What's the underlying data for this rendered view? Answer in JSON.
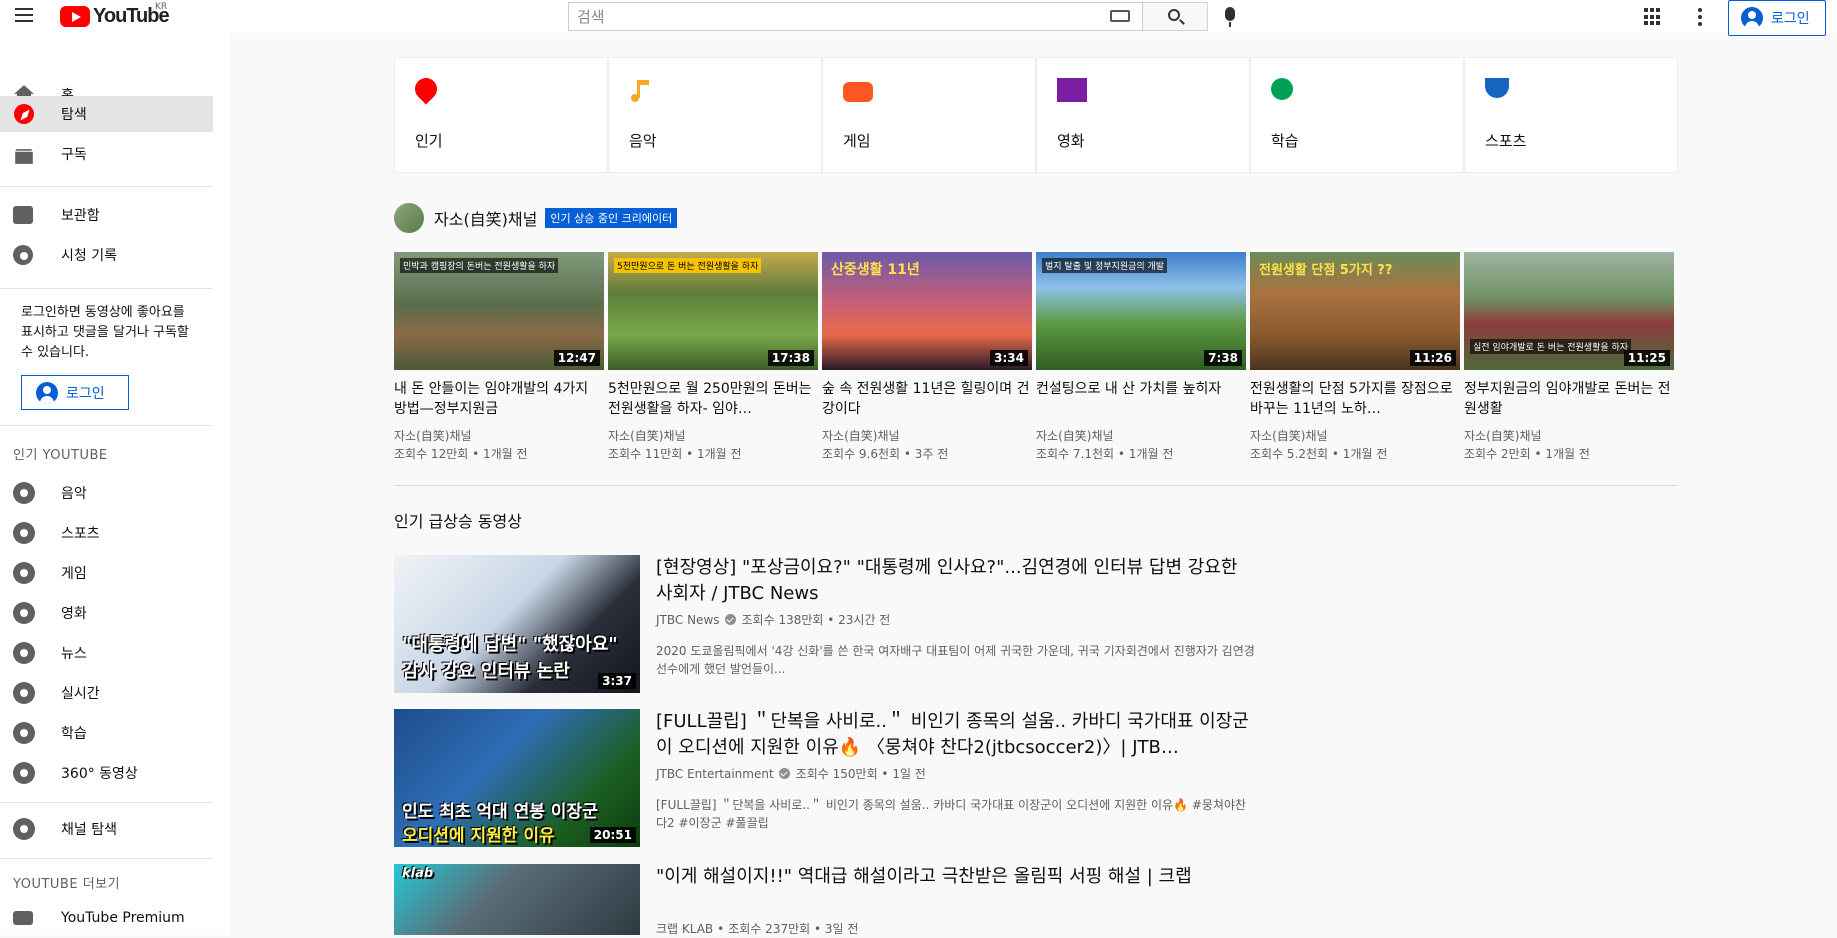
{
  "header": {
    "logo_text": "YouTube",
    "region": "KR",
    "search_placeholder": "검색",
    "login_label": "로그인"
  },
  "sidebar": {
    "main_items": [
      {
        "label": "홈",
        "icon": "home-icon"
      },
      {
        "label": "탐색",
        "icon": "explore-icon",
        "active": true
      },
      {
        "label": "구독",
        "icon": "subscriptions-icon"
      }
    ],
    "library_items": [
      {
        "label": "보관함",
        "icon": "library-icon"
      },
      {
        "label": "시청 기록",
        "icon": "history-icon"
      }
    ],
    "login_prompt": "로그인하면 동영상에 좋아요를 표시하고 댓글을 달거나 구독할 수 있습니다.",
    "login_button": "로그인",
    "popular_heading": "인기 YOUTUBE",
    "popular_items": [
      {
        "label": "음악",
        "icon": "music-icon"
      },
      {
        "label": "스포츠",
        "icon": "trophy-icon"
      },
      {
        "label": "게임",
        "icon": "gaming-icon"
      },
      {
        "label": "영화",
        "icon": "movie-icon"
      },
      {
        "label": "뉴스",
        "icon": "news-icon"
      },
      {
        "label": "실시간",
        "icon": "live-icon"
      },
      {
        "label": "학습",
        "icon": "learning-icon"
      },
      {
        "label": "360° 동영상",
        "icon": "360-icon"
      }
    ],
    "browse_channels": "채널 탐색",
    "more_heading": "YOUTUBE 더보기",
    "more_items": [
      {
        "label": "YouTube Premium",
        "icon": "youtube-icon"
      }
    ]
  },
  "categories": [
    {
      "label": "인기",
      "icon": "trending-icon",
      "color": "#ff0000"
    },
    {
      "label": "음악",
      "icon": "music-note-icon",
      "color": "#f9a825"
    },
    {
      "label": "게임",
      "icon": "gamepad-icon",
      "color": "#ff5722"
    },
    {
      "label": "영화",
      "icon": "film-icon",
      "color": "#7b1fa2"
    },
    {
      "label": "학습",
      "icon": "bulb-icon",
      "color": "#00a152"
    },
    {
      "label": "스포츠",
      "icon": "trophy-icon",
      "color": "#1565c0"
    }
  ],
  "channel_shelf": {
    "channel_name": "자소(自笑)채널",
    "badge": "인기 상승 중인 크리에이터",
    "videos": [
      {
        "title": "내 돈 안들이는 임야개발의 4가지 방법—정부지원금",
        "channel": "자소(自笑)채널",
        "meta": "조회수 12만회 • 1개월 전",
        "duration": "12:47",
        "caption": "민박과 캠핑장의 돈버는 전원생활을 하자"
      },
      {
        "title": "5천만원으로 월 250만원의 돈버는 전원생활을 하자- 임야…",
        "channel": "자소(自笑)채널",
        "meta": "조회수 11만회 • 1개월 전",
        "duration": "17:38",
        "caption": "5천만원으로 돈 버는 전원생활을 하자"
      },
      {
        "title": "숲 속 전원생활 11년은 힐링이며 건강이다",
        "channel": "자소(自笑)채널",
        "meta": "조회수 9.6천회 • 3주 전",
        "duration": "3:34",
        "caption": "산중생활 11년"
      },
      {
        "title": "컨설팅으로 내 산 가치를 높히자",
        "channel": "자소(自笑)채널",
        "meta": "조회수 7.1천회 • 1개월 전",
        "duration": "7:38",
        "caption": "벌지 탈출 및 정부지원금의 개발"
      },
      {
        "title": "전원생활의 단점 5가지를 장점으로 바꾸는 11년의 노하…",
        "channel": "자소(自笑)채널",
        "meta": "조회수 5.2천회 • 1개월 전",
        "duration": "11:26",
        "caption": "전원생활 단점 5가지 ??"
      },
      {
        "title": "정부지원금의 임야개발로 돈버는 전원생활",
        "channel": "자소(自笑)채널",
        "meta": "조회수 2만회 • 1개월 전",
        "duration": "11:25",
        "caption": "실전 임야개발로 돈 버는 전원생활을 하자"
      }
    ]
  },
  "trending": {
    "heading": "인기 급상승 동영상",
    "videos": [
      {
        "title": "[현장영상] \"포상금이요?\" \"대통령께 인사요?\"...김연경에 인터뷰 답변 강요한 사회자 / JTBC News",
        "channel": "JTBC News",
        "meta": "조회수 138만회 • 23시간 전",
        "desc": "2020 도쿄올림픽에서 '4강 신화'를 쓴 한국 여자배구 대표팀이 어제 귀국한 가운데, 귀국 기자회견에서 진행자가 김연경 선수에게 했던 발언들이...",
        "duration": "3:37",
        "caption1": "\"대통령에 답변\" \"했잖아요\"",
        "caption2": "감사 강요 인터뷰 논란"
      },
      {
        "title": "[FULL끌립] ＂단복을 사비로..＂ 비인기 종목의 설움.. 카바디 국가대표 이장군이 오디션에 지원한 이유🔥 〈뭉쳐야 찬다2(jtbcsoccer2)〉| JTB…",
        "channel": "JTBC Entertainment",
        "meta": "조회수 150만회 • 1일 전",
        "desc": "[FULL끌립] ＂단복을 사비로..＂ 비인기 종목의 설움.. 카바디 국가대표 이장군이 오디션에 지원한 이유🔥 #뭉쳐야찬다2 #이장군 #풀끌립",
        "duration": "20:51",
        "caption1": "인도 최초 억대 연봉 이장군",
        "caption2": "오디션에 지원한 이유"
      },
      {
        "title": "\"이게 해설이지!!\" 역대급 해설이라고 극찬받은 올림픽 서핑 해설 | 크랩",
        "channel": "크랩 KLAB",
        "meta": "조회수 237만회 • 3일 전",
        "desc": "",
        "duration": "",
        "caption1": "klab",
        "caption2": ""
      }
    ]
  }
}
